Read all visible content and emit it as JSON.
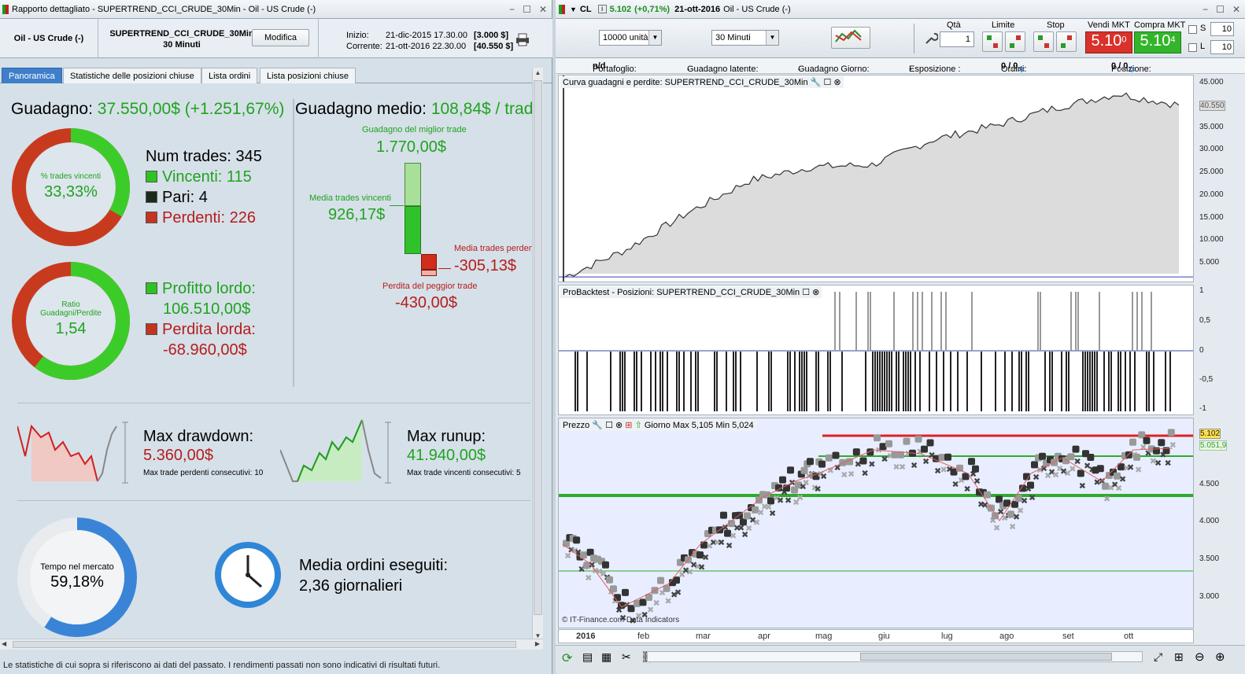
{
  "left": {
    "window_title": "Rapporto dettagliato - SUPERTREND_CCI_CRUDE_30Min - Oil - US Crude (-)",
    "instrument": "Oil - US Crude (-)",
    "strategy_name": "SUPERTREND_CCI_CRUDE_30Min",
    "timeframe": "30 Minuti",
    "edit_button": "Modifica",
    "start_label": "Inizio:",
    "start_date": "21-dic-2015 17.30.00",
    "start_value": "[3.000 $]",
    "current_label": "Corrente:",
    "current_date": "21-ott-2016 22.30.00",
    "current_value": "[40.550 $]",
    "tabs": [
      "Panoramica",
      "Statistiche delle posizioni chiuse",
      "Lista ordini",
      "Lista posizioni chiuse"
    ],
    "gain_label": "Guadagno:",
    "gain_value": "37.550,00$ (+1.251,67%)",
    "avg_gain_label": "Guadagno medio:",
    "avg_gain_value": "108,84$ / trade",
    "win_ratio_label": "% trades vincenti",
    "win_ratio_value": "33,33%",
    "win_ratio": 0.3333,
    "num_trades_label": "Num trades:",
    "num_trades": "345",
    "winners_label": "Vincenti:",
    "winners": "115",
    "even_label": "Pari:",
    "even": "4",
    "losers_label": "Perdenti:",
    "losers": "226",
    "ratio_label_1": "Ratio",
    "ratio_label_2": "Guadagni/Perdite",
    "ratio_value": "1,54",
    "gross_profit_label": "Profitto lordo:",
    "gross_profit": "106.510,00$",
    "gross_loss_label": "Perdita lorda:",
    "gross_loss": "-68.960,00$",
    "best_trade_label": "Guadagno del miglior trade",
    "best_trade": "1.770,00$",
    "avg_win_label": "Media trades vincenti",
    "avg_win": "926,17$",
    "avg_loss_label": "Media trades perdenti",
    "avg_loss": "-305,13$",
    "worst_trade_label": "Perdita del peggior trade",
    "worst_trade": "-430,00$",
    "drawdown_label": "Max drawdown:",
    "drawdown": "5.360,00$",
    "consec_losers_label": "Max trade perdenti consecutivi:",
    "consec_losers": "10",
    "runup_label": "Max runup:",
    "runup": "41.940,00$",
    "consec_winners_label": "Max trade vincenti consecutivi:",
    "consec_winners": "5",
    "market_time_label": "Tempo nel mercato",
    "market_time": "59,18%",
    "market_time_ratio": 0.5918,
    "orders_label": "Media ordini eseguiti:",
    "orders_value": "2,36 giornalieri",
    "status_text": "Le statistiche di cui sopra si riferiscono ai dati del passato. I rendimenti passati non sono indicativi di risultati futuri."
  },
  "right": {
    "symbol": "CL",
    "price": "5.102",
    "change": "(+0,71%)",
    "date": "21-ott-2016",
    "instrument": "Oil - US Crude (-)",
    "qty_select": "10000 unità",
    "timeframe_select": "30 Minuti",
    "qta_label": "Qtà",
    "qta_value": "1",
    "limite_label": "Limite",
    "stop_label": "Stop",
    "sell_label": "Vendi MKT",
    "sell_price": "5.10",
    "sell_sup": "0",
    "buy_label": "Compra MKT",
    "buy_price": "5.10",
    "buy_sup": "4",
    "s_label": "S",
    "s_value": "10",
    "l_label": "L",
    "l_value": "10",
    "portfolio_label": "Portafoglio:",
    "portfolio": "n/d",
    "latent_label": "Guadagno latente:",
    "latent": "-",
    "day_gain_label": "Guadagno Giorno:",
    "day_gain": "-",
    "exposure_label": "Esposizione :",
    "exposure": "-",
    "orders_label": "Ordini:",
    "orders": "0",
    "orders_b": "/ 0",
    "positions_label": "Posizione:",
    "positions": "0",
    "positions_b": "/ 0",
    "equity_title": "Curva guadagni e perdite: SUPERTREND_CCI_CRUDE_30Min",
    "equity_ticks": [
      "45.000",
      "40.000",
      "35.000",
      "30.000",
      "25.000",
      "20.000",
      "15.000",
      "10.000",
      "5.000"
    ],
    "equity_last": "40.550",
    "pos_title": "ProBacktest - Posizioni: SUPERTREND_CCI_CRUDE_30Min",
    "pos_ticks": [
      "1",
      "0,5",
      "0",
      "-0,5",
      "-1"
    ],
    "price_title": "Prezzo",
    "price_info": "Giorno Max 5,105 Min 5,024",
    "price_ticks": [
      "4.500",
      "4.000",
      "3.500",
      "3.000"
    ],
    "price_last": "5.102",
    "price_level": "5.051,9",
    "copyright": "© IT-Finance.com Data Indicators",
    "months": [
      "2016",
      "feb",
      "mar",
      "apr",
      "mag",
      "giu",
      "lug",
      "ago",
      "set",
      "ott"
    ]
  },
  "chart_data": {
    "type": "area",
    "title": "Curva guadagni e perdite: SUPERTREND_CCI_CRUDE_30Min",
    "x": [
      "2016",
      "feb",
      "mar",
      "apr",
      "mag",
      "giu",
      "lug",
      "ago",
      "set",
      "ott"
    ],
    "values": [
      3000,
      9000,
      17000,
      24000,
      27000,
      27500,
      33000,
      36000,
      40000,
      43000,
      40550
    ],
    "ylim": [
      2000,
      47000
    ],
    "grid": false
  }
}
